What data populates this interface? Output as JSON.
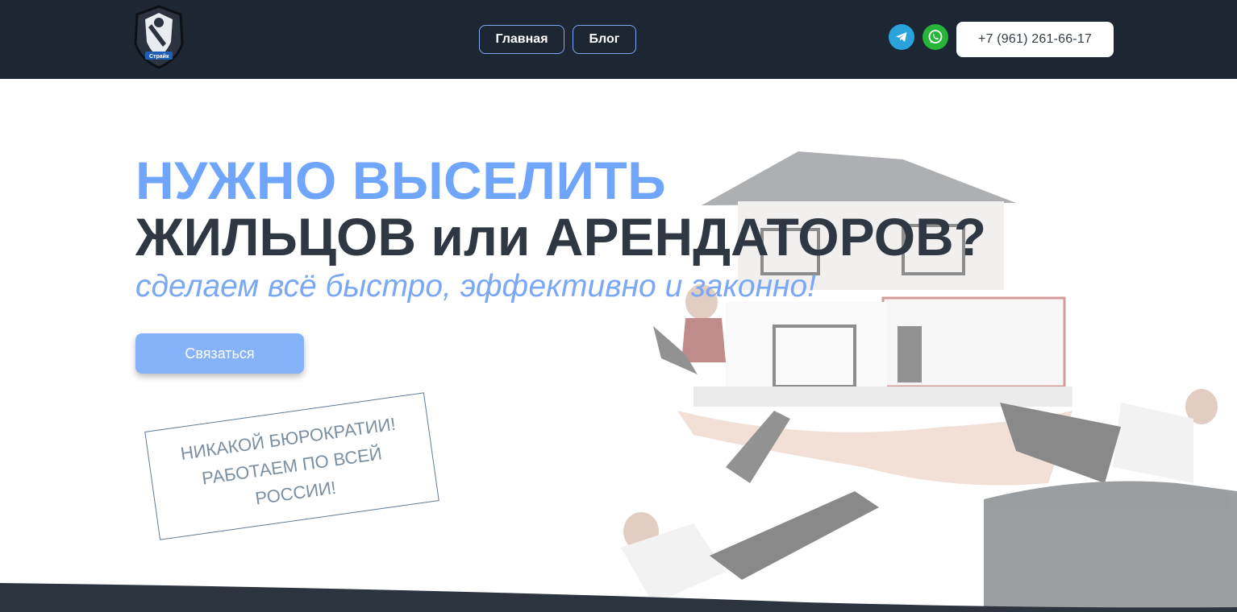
{
  "header": {
    "logo_icon": "knight-shield-logo",
    "logo_text": "Страйк",
    "nav": [
      {
        "label": "Главная"
      },
      {
        "label": "Блог"
      }
    ],
    "socials": [
      {
        "icon": "telegram-icon",
        "color": "#2aa3dd"
      },
      {
        "icon": "whatsapp-icon",
        "color": "#27b43a"
      }
    ],
    "phone": "+7 (961) 261-66-17"
  },
  "hero": {
    "line1": "НУЖНО ВЫСЕЛИТЬ",
    "line2": "ЖИЛЬЦОВ или АРЕНДАТОРОВ?",
    "subtitle": "сделаем всё быстро, эффективно и законно!",
    "cta_label": "Связаться",
    "stamp_lines": [
      "НИКАКОЙ БЮРОКРАТИИ!",
      "РАБОТАЕМ ПО ВСЕЙ",
      "РОССИИ!"
    ]
  },
  "colors": {
    "header_bg": "#1d2733",
    "accent": "#6fa6fb",
    "heading_dark": "#2f3842",
    "cta_bg": "#86b2fa"
  }
}
